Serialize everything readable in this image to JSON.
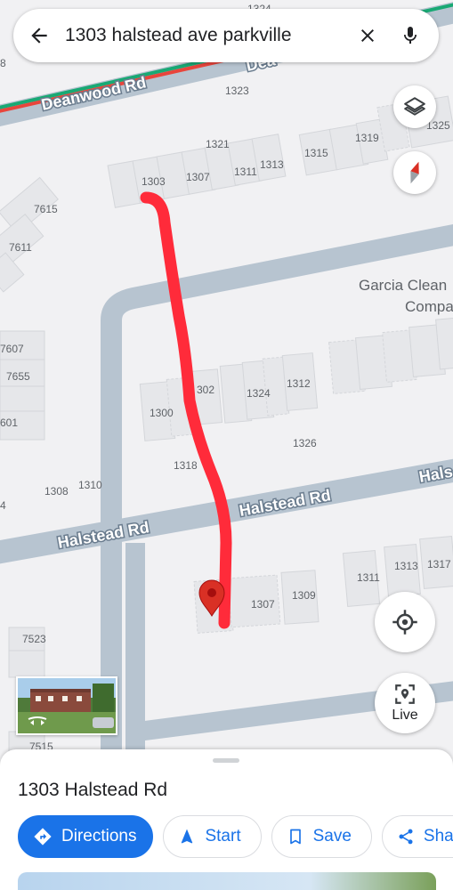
{
  "search": {
    "query": "1303 halstead ave parkville"
  },
  "map": {
    "roads": {
      "deanwood": "Deanwood Rd",
      "deanwood_partial": "Dea",
      "halstead_left": "Halstead Rd",
      "halstead_mid": "Halstead Rd",
      "halstead_right": "Hals"
    },
    "poi": {
      "line1": "Garcia Clean",
      "line2": "Compa"
    },
    "numbers": {
      "n1323": "1323",
      "n1321": "1321",
      "n1303a": "1303",
      "n1307a": "1307",
      "n1311a": "1311",
      "n1313a": "1313",
      "n1315": "1315",
      "n1319": "1319",
      "n1325": "1325",
      "n1324top": "1324",
      "n7615": "7615",
      "n7611": "7611",
      "n7607": "7607",
      "n7655": "7655",
      "n601": "601",
      "n1302": "302",
      "n1300": "1300",
      "n1324": "1324",
      "n1312": "1312",
      "n1326": "1326",
      "n1318": "1318",
      "n1308": "1308",
      "n1310": "1310",
      "n4": "4",
      "n8": "8",
      "n1307b": "1307",
      "n1309": "1309",
      "n1311b": "1311",
      "n1313b": "1313",
      "n1317": "1317",
      "n7523": "7523",
      "n7515": "7515"
    }
  },
  "controls": {
    "live_label": "Live"
  },
  "place": {
    "title": "1303 Halstead Rd",
    "actions": {
      "directions": "Directions",
      "start": "Start",
      "save": "Save",
      "share": "Sha"
    }
  },
  "colors": {
    "accent": "#1a73e8",
    "route_marker": "#ff2b3a",
    "pin": "#d93025",
    "road": "#b7c4d0",
    "building": "#e6e7ea"
  },
  "icons": [
    "back-arrow-icon",
    "close-icon",
    "mic-icon",
    "layers-icon",
    "compass-icon",
    "my-location-icon",
    "live-view-icon",
    "directions-icon",
    "navigation-arrow-icon",
    "bookmark-icon",
    "share-icon",
    "location-pin-icon"
  ]
}
